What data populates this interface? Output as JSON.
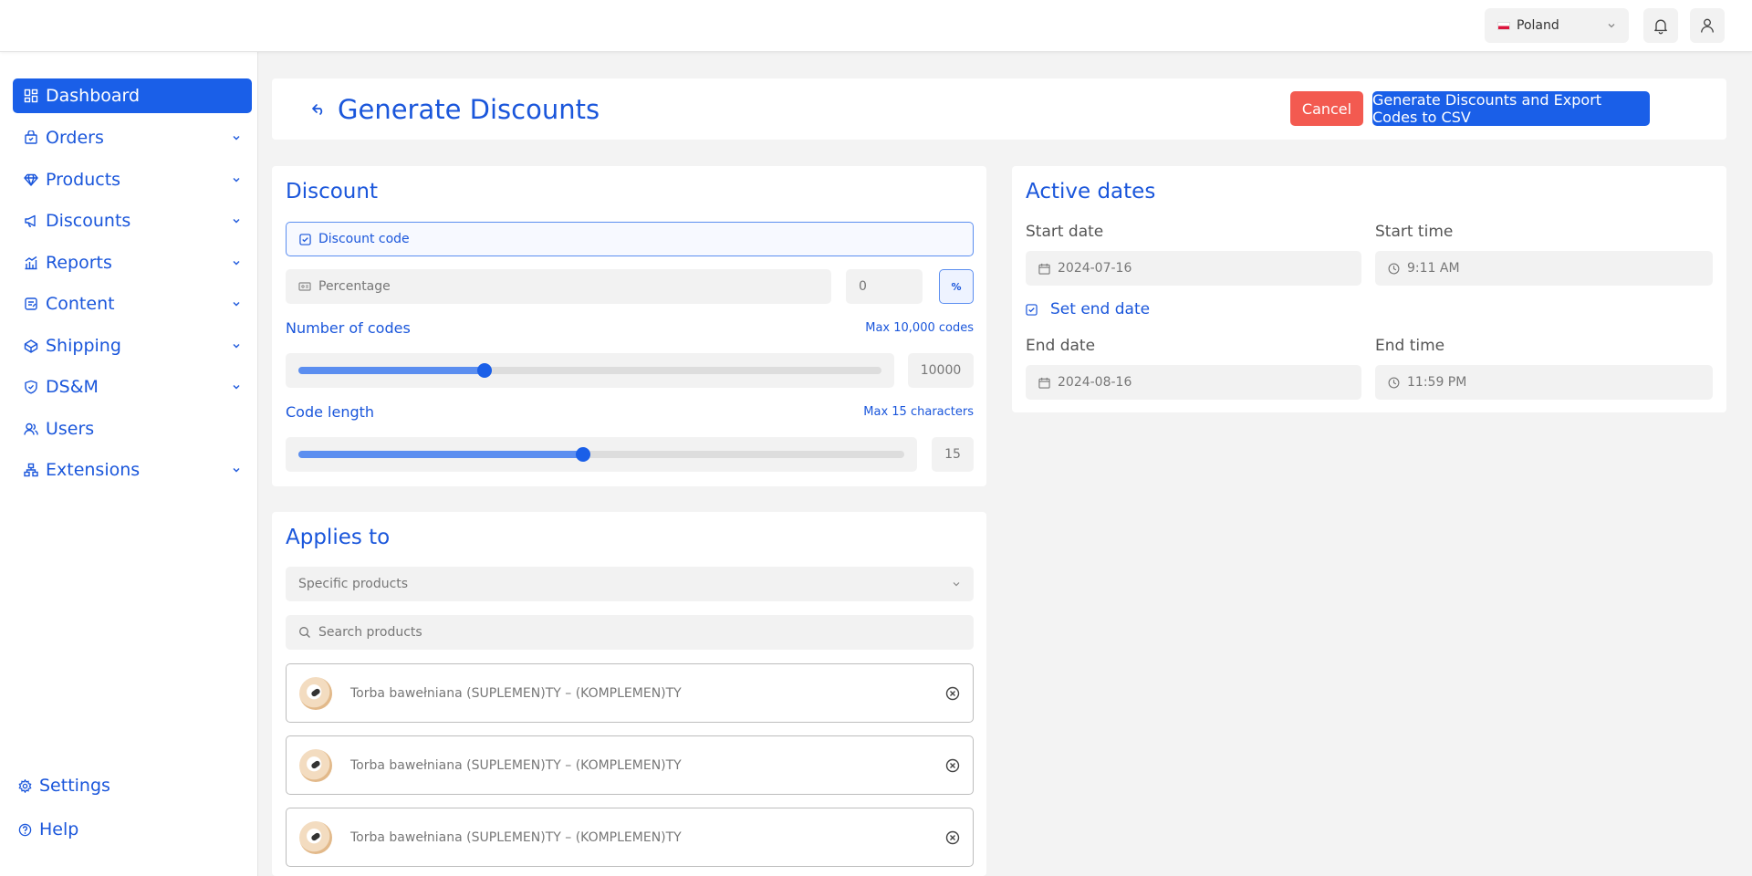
{
  "header": {
    "country": "Poland",
    "icons": {
      "notifications": "bell-icon",
      "account": "user-icon"
    }
  },
  "sidebar": {
    "items": [
      {
        "label": "Dashboard",
        "icon": "grid-icon",
        "active": true
      },
      {
        "label": "Orders",
        "icon": "orders-icon"
      },
      {
        "label": "Products",
        "icon": "diamond-icon"
      },
      {
        "label": "Discounts",
        "icon": "megaphone-icon"
      },
      {
        "label": "Reports",
        "icon": "chart-icon"
      },
      {
        "label": "Content",
        "icon": "content-icon"
      },
      {
        "label": "Shipping",
        "icon": "shipping-icon"
      },
      {
        "label": "DS&M",
        "icon": "shield-icon"
      },
      {
        "label": "Users",
        "icon": "users-icon"
      },
      {
        "label": "Extensions",
        "icon": "extensions-icon"
      }
    ],
    "settings_label": "Settings",
    "help_label": "Help"
  },
  "page": {
    "title": "Generate Discounts",
    "cancel_label": "Cancel",
    "primary_label": "Generate Discounts and Export Codes to CSV"
  },
  "discount": {
    "title": "Discount",
    "code_placeholder": "Discount code",
    "type_placeholder": "Percentage",
    "amount_value": "0",
    "unit_symbol": "%",
    "num_codes_label": "Number of codes",
    "num_codes_max": "Max 10,000 codes",
    "num_codes_value": "10000",
    "num_codes_slider_fraction": 0.32,
    "code_length_label": "Code length",
    "code_length_max": "Max 15 characters",
    "code_length_value": "15",
    "code_length_slider_fraction": 0.47
  },
  "applies_to": {
    "title": "Applies to",
    "scope_value": "Specific products",
    "search_placeholder": "Search products",
    "products": [
      {
        "name": "Torba bawełniana (SUPLEMEN)TY – (KOMPLEMEN)TY"
      },
      {
        "name": "Torba bawełniana (SUPLEMEN)TY – (KOMPLEMEN)TY"
      },
      {
        "name": "Torba bawełniana (SUPLEMEN)TY – (KOMPLEMEN)TY"
      }
    ]
  },
  "active_dates": {
    "title": "Active dates",
    "start_date_label": "Start date",
    "start_date_value": "2024-07-16",
    "start_time_label": "Start time",
    "start_time_value": "9:11 AM",
    "set_end_date_label": "Set end date",
    "end_date_label": "End date",
    "end_date_value": "2024-08-16",
    "end_time_label": "End time",
    "end_time_value": "11:59 PM"
  },
  "colors": {
    "accent": "#1a5fe8",
    "accent_text": "#1a56db",
    "cancel": "#f35a50",
    "background": "#f3f3f3"
  }
}
